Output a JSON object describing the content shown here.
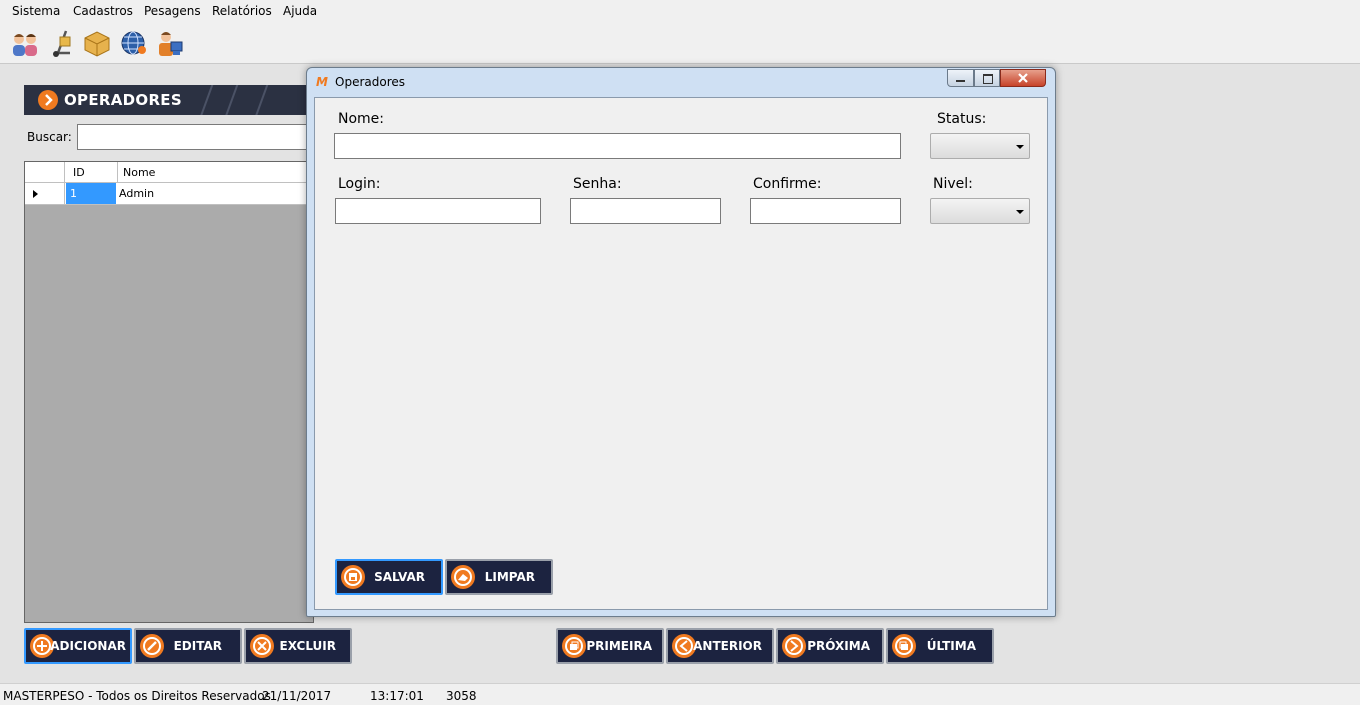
{
  "menu": {
    "items": [
      "Sistema",
      "Cadastros",
      "Pesagens",
      "Relatórios",
      "Ajuda"
    ]
  },
  "toolbar": {
    "icons": [
      "operators-people-icon",
      "hand-truck-icon",
      "package-box-icon",
      "globe-network-icon",
      "user-computer-icon"
    ]
  },
  "main": {
    "banner_title": "OPERADORES",
    "search_label": "Buscar:",
    "search_value": "",
    "grid": {
      "columns": [
        "ID",
        "Nome"
      ],
      "rows": [
        {
          "id": "1",
          "nome": "Admin"
        }
      ]
    },
    "buttons": {
      "add": "ADICIONAR",
      "edit": "EDITAR",
      "delete": "EXCLUIR",
      "first": "PRIMEIRA",
      "previous": "ANTERIOR",
      "next": "PRÓXIMA",
      "last": "ÚLTIMA"
    }
  },
  "dialog": {
    "logo": "M",
    "title": "Operadores",
    "fields": {
      "nome_label": "Nome:",
      "nome_value": "",
      "status_label": "Status:",
      "status_value": "",
      "login_label": "Login:",
      "login_value": "",
      "senha_label": "Senha:",
      "senha_value": "",
      "confirme_label": "Confirme:",
      "confirme_value": "",
      "nivel_label": "Nivel:",
      "nivel_value": ""
    },
    "buttons": {
      "save": "SALVAR",
      "clear": "LIMPAR"
    }
  },
  "statusbar": {
    "company": "MASTERPESO - Todos os Direitos Reservados",
    "date": "21/11/2017",
    "time": "13:17:01",
    "code": "3058"
  },
  "colors": {
    "accent_orange": "#f07a20",
    "button_navy": "#1c2340",
    "selection_blue": "#3399ff",
    "banner_dark": "#2b3142"
  }
}
